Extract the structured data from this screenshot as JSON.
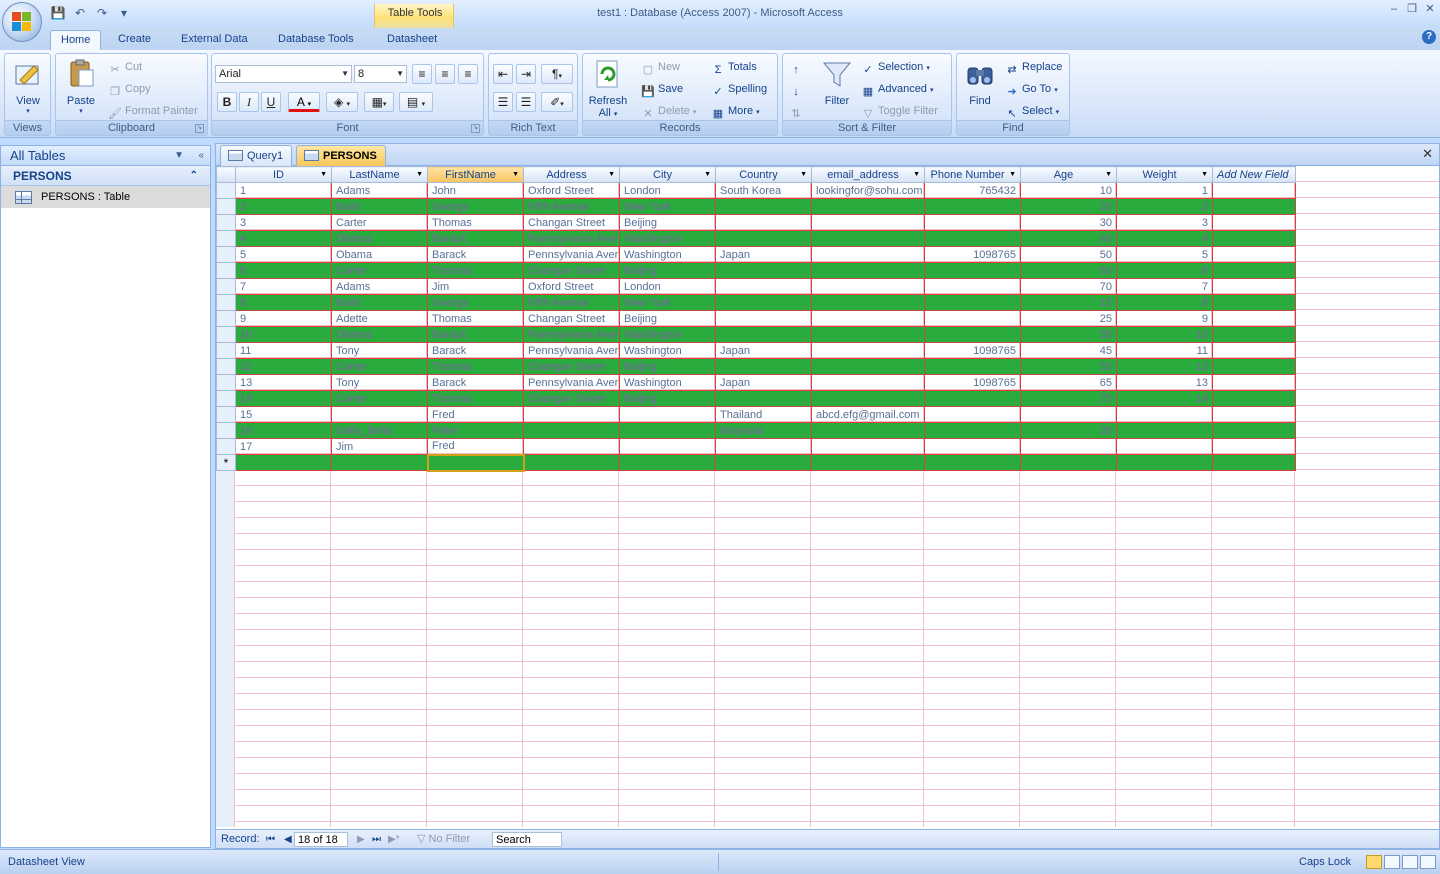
{
  "window": {
    "title": "test1 : Database (Access 2007) - Microsoft Access",
    "contextual_tab_group": "Table Tools"
  },
  "ribbon_tabs": [
    "Home",
    "Create",
    "External Data",
    "Database Tools",
    "Datasheet"
  ],
  "ribbon": {
    "views": {
      "label": "Views",
      "view_button": "View"
    },
    "clipboard": {
      "label": "Clipboard",
      "paste": "Paste",
      "cut": "Cut",
      "copy": "Copy",
      "format_painter": "Format Painter"
    },
    "font": {
      "label": "Font",
      "font_name": "Arial",
      "font_size": "8",
      "bold": "B",
      "italic": "I",
      "underline": "U",
      "font_color": "A"
    },
    "rich_text": {
      "label": "Rich Text"
    },
    "records": {
      "label": "Records",
      "refresh": "Refresh",
      "refresh_sub": "All",
      "new": "New",
      "save": "Save",
      "delete": "Delete",
      "totals": "Totals",
      "spelling": "Spelling",
      "more": "More"
    },
    "sort_filter": {
      "label": "Sort & Filter",
      "filter": "Filter",
      "selection": "Selection",
      "advanced": "Advanced",
      "toggle_filter": "Toggle Filter"
    },
    "find": {
      "label": "Find",
      "find": "Find",
      "replace": "Replace",
      "go_to": "Go To",
      "select": "Select"
    }
  },
  "nav_pane": {
    "header": "All Tables",
    "group": "PERSONS",
    "items": [
      {
        "label": "PERSONS : Table"
      }
    ]
  },
  "doc_tabs": [
    {
      "label": "Query1",
      "active": false
    },
    {
      "label": "PERSONS",
      "active": true
    }
  ],
  "table": {
    "columns": [
      "ID",
      "LastName",
      "FirstName",
      "Address",
      "City",
      "Country",
      "email_address",
      "Phone Number",
      "Age",
      "Weight",
      "Add New Field"
    ],
    "rows": [
      [
        "1",
        "Adams",
        "John",
        "Oxford Street",
        "London",
        "South Korea",
        "lookingfor@sohu.com",
        "765432",
        "10",
        "1"
      ],
      [
        "2",
        "Bush",
        "George",
        "Fifth Avenue",
        "New York",
        "",
        "",
        "",
        "20",
        "2"
      ],
      [
        "3",
        "Carter",
        "Thomas",
        "Changan Street",
        "Beijing",
        "",
        "",
        "",
        "30",
        "3"
      ],
      [
        "4",
        "Obama",
        "Barack",
        "Pennsylvania Aver",
        "Washington",
        "",
        "",
        "",
        "40",
        "4"
      ],
      [
        "5",
        "Obama",
        "Barack",
        "Pennsylvania Aver",
        "Washington",
        "Japan",
        "",
        "1098765",
        "50",
        "5"
      ],
      [
        "6",
        "Carter",
        "Thomas",
        "Changan Street",
        "Beijing",
        "",
        "",
        "",
        "60",
        "6"
      ],
      [
        "7",
        "Adams",
        "Jim",
        "Oxford Street",
        "London",
        "",
        "",
        "",
        "70",
        "7"
      ],
      [
        "8",
        "Bush",
        "George",
        "Fifth Avenue",
        "New York",
        "",
        "",
        "",
        "15",
        "8"
      ],
      [
        "9",
        "Adette",
        "Thomas",
        "Changan Street",
        "Beijing",
        "",
        "",
        "",
        "25",
        "9"
      ],
      [
        "10",
        "Obama",
        "Barack",
        "Pennsylvania Aver",
        "Washington",
        "",
        "",
        "",
        "35",
        "10"
      ],
      [
        "11",
        "Tony",
        "Barack",
        "Pennsylvania Aver",
        "Washington",
        "Japan",
        "",
        "1098765",
        "45",
        "11"
      ],
      [
        "12",
        "Carter",
        "Thomas",
        "Changan Street",
        "Beijing",
        "",
        "",
        "",
        "55",
        "12"
      ],
      [
        "13",
        "Tony",
        "Barack",
        "Pennsylvania Aver",
        "Washington",
        "Japan",
        "",
        "1098765",
        "65",
        "13"
      ],
      [
        "14",
        "Carter",
        "Thomas",
        "Changan Street",
        "Beijing",
        "",
        "",
        "",
        "75",
        "14"
      ],
      [
        "15",
        "",
        "Fred",
        "",
        "",
        "Thailand",
        "abcd.efg@gmail.com",
        "",
        "",
        ""
      ],
      [
        "16",
        "Della_Bella",
        "Peter",
        "",
        "",
        "Maylasia",
        "",
        "",
        "28",
        ""
      ],
      [
        "17",
        "Jim",
        "Fred",
        "",
        "",
        "",
        "",
        "",
        "",
        ""
      ]
    ],
    "new_row_marker": "*"
  },
  "record_nav": {
    "label": "Record:",
    "position": "18 of 18",
    "filter": "No Filter",
    "search_placeholder": "Search"
  },
  "status_bar": {
    "view": "Datasheet View",
    "caps_lock": "Caps Lock"
  },
  "colors": {
    "alt_row": "#2aab3e",
    "grid_line": "#e23b3b",
    "ribbon_text": "#15428b"
  }
}
